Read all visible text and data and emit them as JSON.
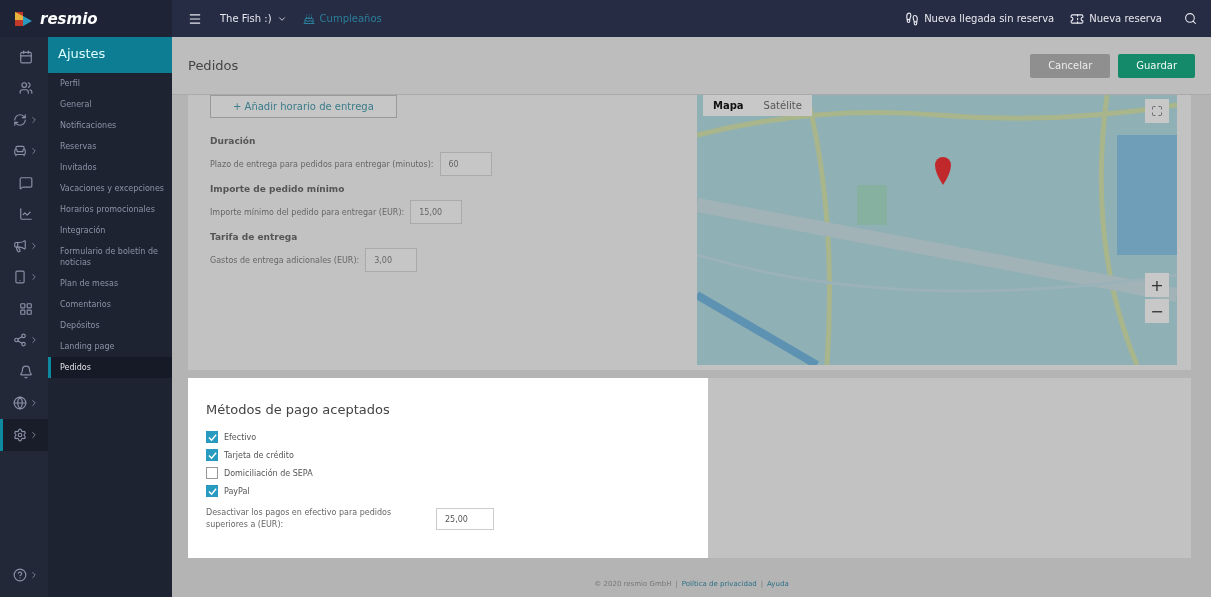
{
  "header": {
    "brand": "resmio",
    "venue": "The Fish :)",
    "birthday": "Cumpleaños",
    "actions": [
      "Nueva llegada sin reserva",
      "Nueva reserva"
    ]
  },
  "rail": [
    {
      "arrow": false,
      "selected": false
    },
    {
      "arrow": false,
      "selected": false
    },
    {
      "arrow": true,
      "selected": false
    },
    {
      "arrow": true,
      "selected": false
    },
    {
      "arrow": false,
      "selected": false
    },
    {
      "arrow": false,
      "selected": false
    },
    {
      "arrow": true,
      "selected": false
    },
    {
      "arrow": true,
      "selected": false
    },
    {
      "arrow": false,
      "selected": false
    },
    {
      "arrow": true,
      "selected": false
    },
    {
      "arrow": false,
      "selected": false
    },
    {
      "arrow": true,
      "selected": false
    },
    {
      "arrow": true,
      "selected": true
    }
  ],
  "rail_bottom": {
    "arrow": true
  },
  "submenu": {
    "title": "Ajustes",
    "items": [
      {
        "label": "Perfil",
        "selected": false
      },
      {
        "label": "General",
        "selected": false
      },
      {
        "label": "Notificaciones",
        "selected": false
      },
      {
        "label": "Reservas",
        "selected": false
      },
      {
        "label": "Invitados",
        "selected": false
      },
      {
        "label": "Vacaciones y excepciones",
        "selected": false
      },
      {
        "label": "Horarios promocionales",
        "selected": false
      },
      {
        "label": "Integración",
        "selected": false
      },
      {
        "label": "Formulario de boletín de noticias",
        "selected": false
      },
      {
        "label": "Plan de mesas",
        "selected": false
      },
      {
        "label": "Comentarios",
        "selected": false
      },
      {
        "label": "Depósitos",
        "selected": false
      },
      {
        "label": "Landing page",
        "selected": false
      },
      {
        "label": "Pedidos",
        "selected": true
      }
    ]
  },
  "page": {
    "title": "Pedidos",
    "buttons": [
      {
        "label": "Cancelar",
        "disabled": true
      },
      {
        "label": "Guardar",
        "disabled": false
      }
    ]
  },
  "delivery": {
    "add_button": "+ Añadir horario de entrega",
    "sections": [
      {
        "heading": "Duración",
        "label": "Plazo de entrega para pedidos para entregar (minutos):",
        "value": "60"
      },
      {
        "heading": "Importe de pedido mínimo",
        "label": "Importe mínimo del pedido para entregar (EUR):",
        "value": "15,00"
      },
      {
        "heading": "Tarifa de entrega",
        "label": "Gastos de entrega adicionales (EUR):",
        "value": "3,00"
      }
    ]
  },
  "map": {
    "kind": "picture",
    "tabs": [
      {
        "label": "Mapa",
        "selected": true
      },
      {
        "label": "Satélite",
        "selected": false
      }
    ],
    "zoom_in": "+",
    "zoom_out": "−"
  },
  "payment": {
    "title": "Métodos de pago aceptados",
    "methods": [
      {
        "label": "Efectivo",
        "checked": true
      },
      {
        "label": "Tarjeta de crédito",
        "checked": true
      },
      {
        "label": "Domiciliación de SEPA",
        "checked": false
      },
      {
        "label": "PayPal",
        "checked": true
      }
    ],
    "limit_label": "Desactivar los pagos en efectivo para pedidos superiores a (EUR):",
    "limit_value": "25,00"
  },
  "footer": {
    "copyright": "© 2020 resmio GmbH",
    "separator": "|",
    "links": [
      "Política de privacidad",
      "Ayuda"
    ]
  }
}
